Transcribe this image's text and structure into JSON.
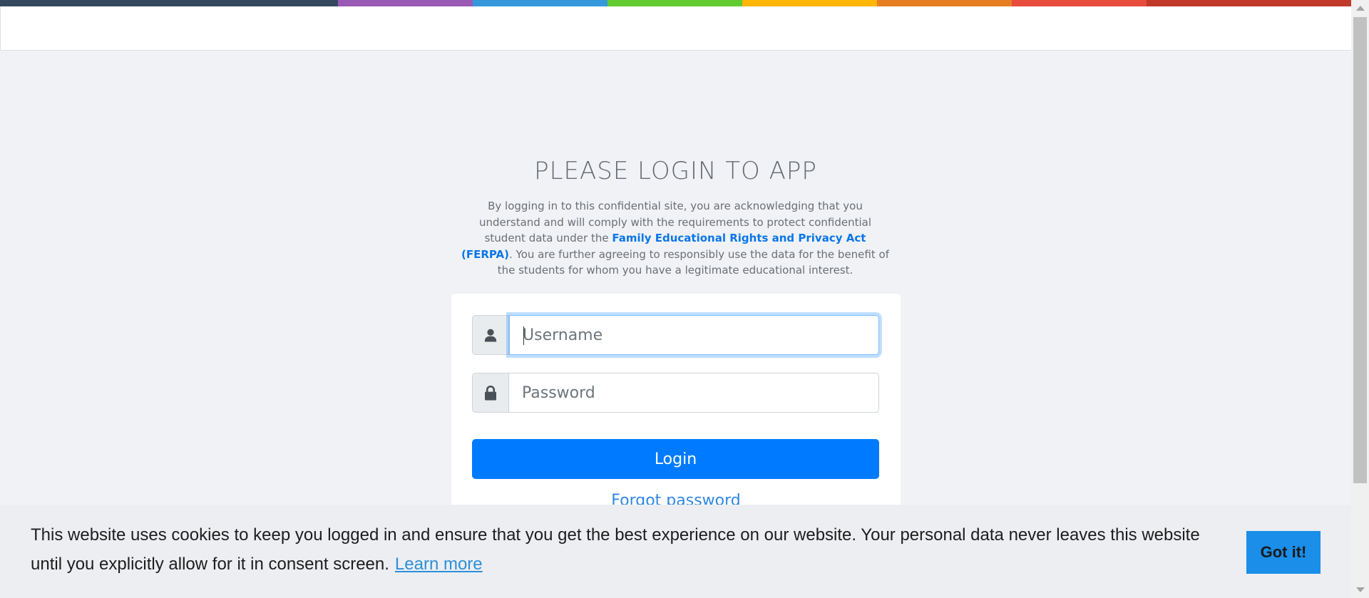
{
  "header": {
    "rainbow_colors": [
      "#34495e",
      "#9b59b6",
      "#3498db",
      "#62cb31",
      "#ffb606",
      "#e67e22",
      "#e74c3c",
      "#c0392b"
    ]
  },
  "login": {
    "title": "PLEASE LOGIN TO APP",
    "disclaimer_before": "By logging in to this confidential site, you are acknowledging that you understand and will comply with the requirements to protect confidential student data under the ",
    "ferpa_link": "Family Educational Rights and Privacy Act (FERPA)",
    "disclaimer_after": ". You are further agreeing to responsibly use the data for the benefit of the students for whom you have a legitimate educational interest.",
    "username_placeholder": "Username",
    "password_placeholder": "Password",
    "username_icon": "user-icon",
    "password_icon": "lock-icon",
    "login_label": "Login",
    "forgot_label": "Forgot password",
    "accent_color": "#007bff"
  },
  "cookie": {
    "message": "This website uses cookies to keep you logged in and ensure that you get the best experience on our website. Your personal data never leaves this website until you explicitly allow for it in consent screen.",
    "learn_more": "Learn more",
    "accept_label": "Got it!"
  }
}
